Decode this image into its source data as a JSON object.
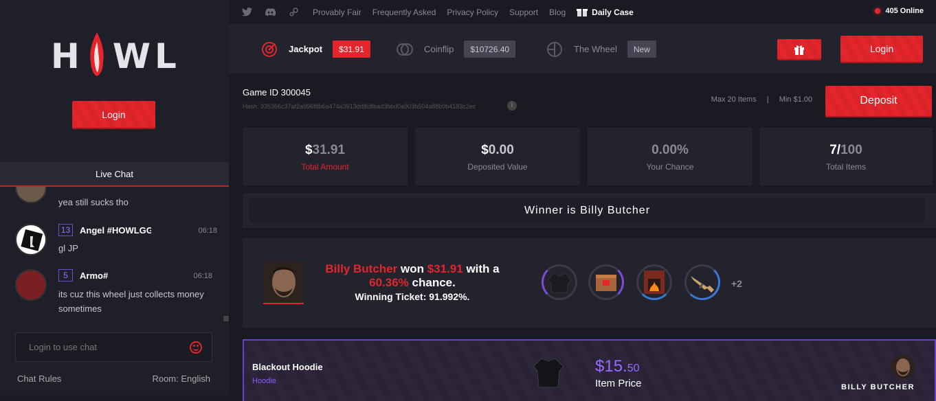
{
  "sidebar": {
    "logo": {
      "left": "H",
      "right": "WL"
    },
    "login_label": "Login",
    "live_chat_label": "Live Chat",
    "messages": [
      {
        "text": "yea still sucks tho"
      },
      {
        "level": "13",
        "username": "Angel #HOWLGG",
        "time": "06:18",
        "text": "gl JP"
      },
      {
        "level": "5",
        "username": "Armo#",
        "time": "06:18",
        "text": "its cuz this wheel just collects money sometimes"
      }
    ],
    "chat_placeholder": "Login to use chat",
    "chat_rules": "Chat Rules",
    "room": "Room: English"
  },
  "topbar": {
    "links": [
      "Provably Fair",
      "Frequently Asked",
      "Privacy Policy",
      "Support",
      "Blog"
    ],
    "daily_case": "Daily Case",
    "online": "405 Online"
  },
  "gamebar": {
    "tabs": [
      {
        "label": "Jackpot",
        "badge": "$31.91"
      },
      {
        "label": "Coinflip",
        "badge": "$10726.40"
      },
      {
        "label": "The Wheel",
        "badge": "New"
      }
    ],
    "login_label": "Login"
  },
  "game": {
    "id": "Game ID 300045",
    "hash": "Hash: 935366c37af2a996f8b6a474a3913dd8c8bad3bbd0a903b504a88b0b4183c2ec",
    "max_items": "Max 20 Items",
    "separator": "|",
    "min_value": "Min $1.00",
    "deposit_label": "Deposit"
  },
  "stats": [
    {
      "prefix": "$",
      "value": "31.91",
      "label": "Total Amount"
    },
    {
      "prefix": "$",
      "value": "0.00",
      "label": "Deposited Value"
    },
    {
      "prefix": "",
      "value": "0.00%",
      "label": "Your Chance"
    },
    {
      "prefix": "7/",
      "value": "100",
      "label": "Total Items"
    }
  ],
  "winner_banner": "Winner is Billy Butcher",
  "result": {
    "name": "Billy Butcher",
    "won": "won",
    "amount": "$31.91",
    "with_a": "with a",
    "chance": "60.36%",
    "chance_suffix": "chance.",
    "ticket": "Winning Ticket: 91.992%.",
    "more_items": "+2"
  },
  "item_card": {
    "name": "Blackout Hoodie",
    "category": "Hoodie",
    "price_dollars": "$15.",
    "price_cents": "50",
    "price_label": "Item Price",
    "owner": "BILLY BUTCHER"
  },
  "colors": {
    "accent_red": "#e4252c",
    "accent_purple": "#6a40d8",
    "bg": "#1a1a23",
    "panel": "#23232e"
  }
}
